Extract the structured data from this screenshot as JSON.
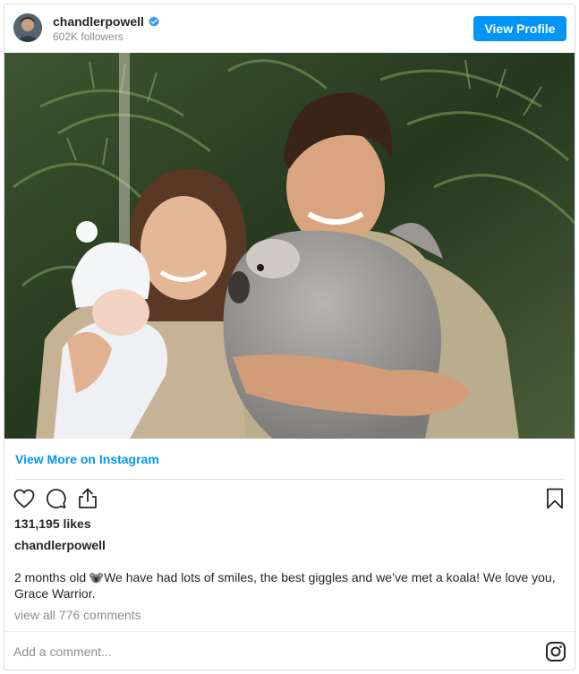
{
  "header": {
    "username": "chandlerpowell",
    "followers": "602K followers",
    "view_profile_label": "View Profile",
    "avatar_icon": "avatar",
    "verified_icon": "verified-badge-icon"
  },
  "post": {
    "view_more_label": "View More on Instagram",
    "likes": "131,195 likes",
    "owner": "chandlerpowell",
    "caption_before_emoji": "2 months old ",
    "caption_emoji": "koala-emoji",
    "caption_after_emoji": "We have had lots of smiles, the best giggles and we’ve met a koala! We love you, Grace Warrior.",
    "view_comments": "view all 776 comments",
    "icons": [
      "heart-icon",
      "comment-icon",
      "share-icon",
      "bookmark-icon"
    ]
  },
  "comment": {
    "placeholder": "Add a comment...",
    "instagram_icon": "instagram-icon"
  },
  "colors": {
    "accent": "#0095f6",
    "muted": "#8e8e8e",
    "border": "#dbdbdb"
  }
}
